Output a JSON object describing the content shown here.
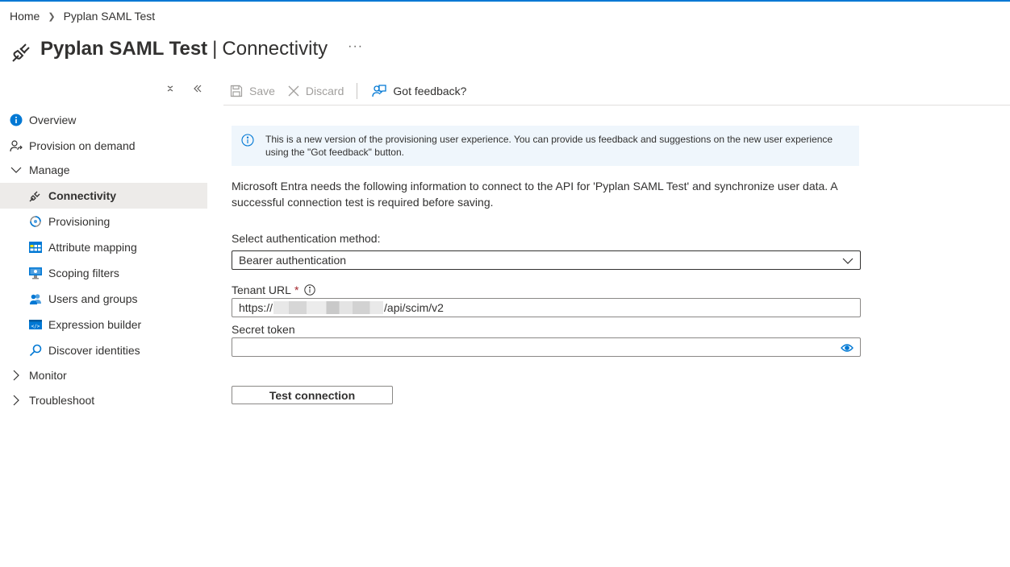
{
  "breadcrumb": {
    "home": "Home",
    "current": "Pyplan SAML Test"
  },
  "header": {
    "title": "Pyplan SAML Test",
    "separator": "|",
    "subtitle": "Connectivity",
    "more": "···"
  },
  "sidebar": {
    "items": [
      {
        "label": "Overview",
        "icon": "info-icon",
        "level": "top"
      },
      {
        "label": "Provision on demand",
        "icon": "provision-on-demand-icon",
        "level": "top"
      },
      {
        "label": "Manage",
        "icon": "chevron-down-icon",
        "level": "top",
        "expanded": true
      },
      {
        "label": "Connectivity",
        "icon": "plug-icon",
        "level": "child",
        "active": true
      },
      {
        "label": "Provisioning",
        "icon": "provisioning-icon",
        "level": "child"
      },
      {
        "label": "Attribute mapping",
        "icon": "table-icon",
        "level": "child"
      },
      {
        "label": "Scoping filters",
        "icon": "monitor-icon",
        "level": "child"
      },
      {
        "label": "Users and groups",
        "icon": "users-icon",
        "level": "child"
      },
      {
        "label": "Expression builder",
        "icon": "code-icon",
        "level": "child"
      },
      {
        "label": "Discover identities",
        "icon": "search-icon",
        "level": "child"
      },
      {
        "label": "Monitor",
        "icon": "chevron-right-icon",
        "level": "top",
        "expanded": false
      },
      {
        "label": "Troubleshoot",
        "icon": "chevron-right-icon",
        "level": "top",
        "expanded": false
      }
    ]
  },
  "toolbar": {
    "save_label": "Save",
    "discard_label": "Discard",
    "feedback_label": "Got feedback?"
  },
  "banner": {
    "text": "This is a new version of the provisioning user experience. You can provide us feedback and suggestions on the new user experience using the \"Got feedback\" button."
  },
  "description": "Microsoft Entra needs the following information to connect to the API for 'Pyplan SAML Test' and synchronize user data. A successful connection test is required before saving.",
  "form": {
    "auth_label": "Select authentication method:",
    "auth_value": "Bearer authentication",
    "tenant_label": "Tenant URL",
    "required_mark": "*",
    "tenant_prefix": "https://",
    "tenant_suffix": "/api/scim/v2",
    "secret_label": "Secret token",
    "secret_value": "",
    "test_button": "Test connection"
  },
  "colors": {
    "accent": "#0078d4",
    "active_bg": "#edebe9",
    "banner_bg": "#eff6fc",
    "required": "#a4262c"
  }
}
